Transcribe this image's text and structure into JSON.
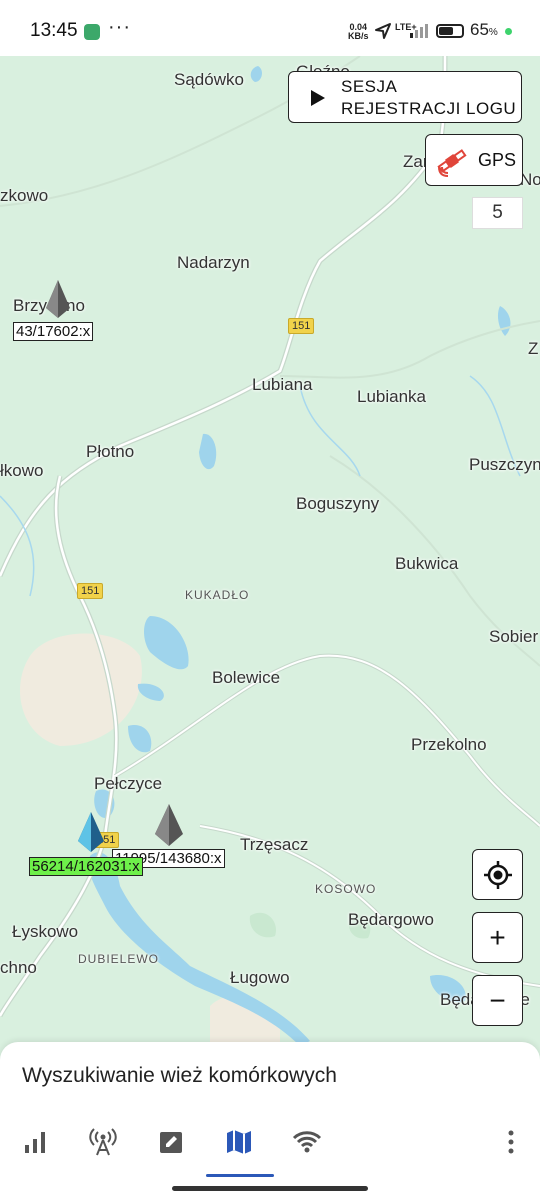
{
  "status_bar": {
    "time": "13:45",
    "speed_value": "0.04",
    "speed_unit": "KB/s",
    "network": "LTE+",
    "battery_percent": "65",
    "battery_symbol": "%",
    "battery_level": 0.65
  },
  "map": {
    "places": [
      {
        "name": "Sądówko"
      },
      {
        "name": "Gleźno"
      },
      {
        "name": "Zam"
      },
      {
        "name": "No"
      },
      {
        "name": "zkowo"
      },
      {
        "name": "Nadarzyn"
      },
      {
        "name": "Brzy"
      },
      {
        "name": "no"
      },
      {
        "name": "Z"
      },
      {
        "name": "Lubiana"
      },
      {
        "name": "Lubianka"
      },
      {
        "name": "Płotno"
      },
      {
        "name": "łkowo"
      },
      {
        "name": "Puszczyn"
      },
      {
        "name": "Boguszyny"
      },
      {
        "name": "Bukwica"
      },
      {
        "name": "KUKADŁO"
      },
      {
        "name": "Sobier"
      },
      {
        "name": "Bolewice"
      },
      {
        "name": "Przekolno"
      },
      {
        "name": "Pełczyce"
      },
      {
        "name": "Trzęsacz"
      },
      {
        "name": "KOSOWO"
      },
      {
        "name": "Łyskowo"
      },
      {
        "name": "Będargowo"
      },
      {
        "name": "chno"
      },
      {
        "name": "DUBIELEWO"
      },
      {
        "name": "Ługowo"
      },
      {
        "name": "Będargowie"
      }
    ],
    "road_shields": [
      "151",
      "151",
      "151"
    ],
    "towers": [
      {
        "label": "43/17602:x",
        "active": false
      },
      {
        "label": "56214/162031:x",
        "active": true
      },
      {
        "label": "11995/143680:x",
        "active": false
      }
    ],
    "tower_colors": {
      "active": "#6ef04a",
      "inactive": "#ffffff"
    }
  },
  "controls": {
    "session_button": {
      "line1": "SESJA",
      "line2": "REJESTRACJI LOGU",
      "icon": "play-icon"
    },
    "gps_button": {
      "label": "GPS",
      "icon": "satellite-icon",
      "icon_color": "#e0453a"
    },
    "tower_count": "5",
    "locate_icon": "crosshair-icon",
    "zoom_in": "+",
    "zoom_out": "−"
  },
  "bottom_sheet": {
    "title": "Wyszukiwanie wież komórkowych",
    "nav_items": [
      {
        "icon": "signal-bars-icon",
        "active": false
      },
      {
        "icon": "cell-tower-icon",
        "active": false
      },
      {
        "icon": "edit-note-icon",
        "active": false
      },
      {
        "icon": "map-icon",
        "active": true
      },
      {
        "icon": "wifi-icon",
        "active": false
      },
      {
        "icon": "more-vert-icon",
        "active": false
      }
    ],
    "accent_color": "#2b58b8"
  }
}
